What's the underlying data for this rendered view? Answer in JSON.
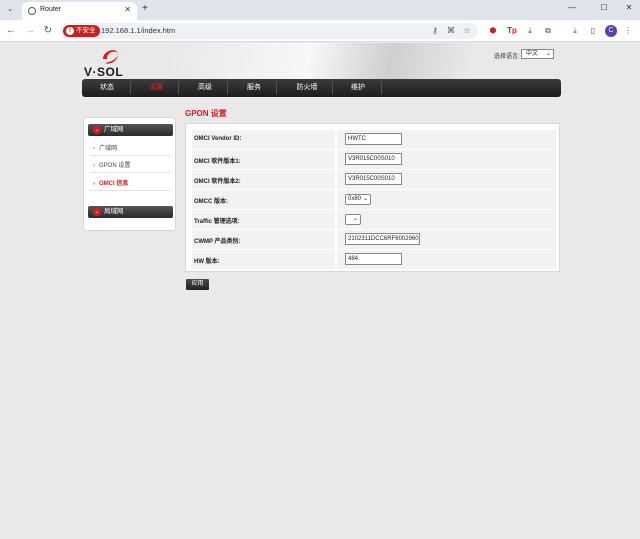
{
  "browser": {
    "tab_title": "Router",
    "url": "192.168.1.1/index.htm",
    "security_label": "不安全"
  },
  "header": {
    "logo_text": "V·SOL",
    "language_label": "选择语言:",
    "language_value": "中文"
  },
  "menu": [
    "状态",
    "设置",
    "高级",
    "服务",
    "防火墙",
    "维护"
  ],
  "sidebar": {
    "section1": "广域网",
    "items": [
      "广域网",
      "GPON 设置",
      "OMCI 信息"
    ],
    "section2": "局域网"
  },
  "form": {
    "title": "GPON 设置",
    "rows": [
      {
        "label": "OMCI Vendor ID:",
        "value": "HWTC"
      },
      {
        "label": "OMCI 软件版本1:",
        "value": "V3R015C00S010"
      },
      {
        "label": "OMCI 软件版本2:",
        "value": "V3R015C00S010"
      },
      {
        "label": "OMCC 版本:",
        "value": "0x80"
      },
      {
        "label": "Traffic 管理选项:",
        "value": ""
      },
      {
        "label": "CWMP 产品类别:",
        "value": "2102311DCC6RF6002960"
      },
      {
        "label": "HW 版本:",
        "value": "484."
      }
    ],
    "apply_label": "应用"
  },
  "colors": {
    "accent": "#d41e22",
    "menubar": "#2a2a2a"
  }
}
